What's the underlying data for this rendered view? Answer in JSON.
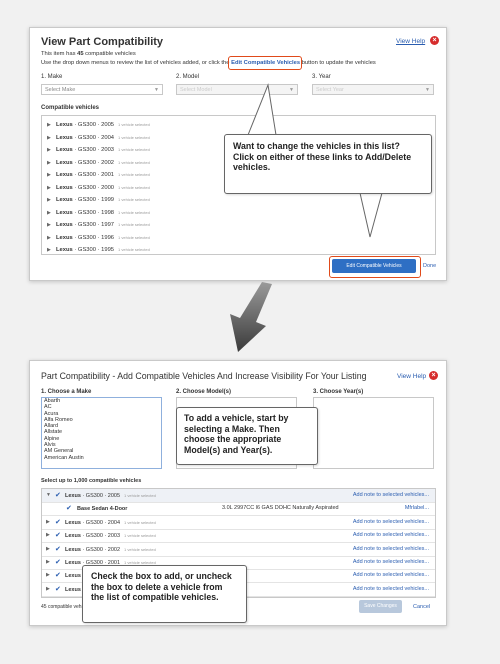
{
  "top": {
    "title": "View Part Compatibility",
    "help": "View Help",
    "line1_pre": "This item has ",
    "line1_count": "45",
    "line1_post": " compatible vehicles",
    "line2_pre": "Use the drop down menus to review the list of vehicles added, or click the",
    "line2_link": "Edit Compatible Vehicles",
    "line2_post": "button to update the vehicles",
    "make_label": "1. Make",
    "model_label": "2. Model",
    "year_label": "3. Year",
    "make_value": "Select Make",
    "model_value": "Select Model",
    "year_value": "Select Year",
    "list_title": "Compatible vehicles",
    "rows": [
      {
        "name": "Lexus",
        "desc": "· GS300 · 2005",
        "sub": "1 vehicle selected"
      },
      {
        "name": "Lexus",
        "desc": "· GS300 · 2004",
        "sub": "1 vehicle selected"
      },
      {
        "name": "Lexus",
        "desc": "· GS300 · 2003",
        "sub": "1 vehicle selected"
      },
      {
        "name": "Lexus",
        "desc": "· GS300 · 2002",
        "sub": "1 vehicle selected"
      },
      {
        "name": "Lexus",
        "desc": "· GS300 · 2001",
        "sub": "1 vehicle selected"
      },
      {
        "name": "Lexus",
        "desc": "· GS300 · 2000",
        "sub": "1 vehicle selected"
      },
      {
        "name": "Lexus",
        "desc": "· GS300 · 1999",
        "sub": "1 vehicle selected"
      },
      {
        "name": "Lexus",
        "desc": "· GS300 · 1998",
        "sub": "1 vehicle selected"
      },
      {
        "name": "Lexus",
        "desc": "· GS300 · 1997",
        "sub": "1 vehicle selected"
      },
      {
        "name": "Lexus",
        "desc": "· GS300 · 1996",
        "sub": "1 vehicle selected"
      },
      {
        "name": "Lexus",
        "desc": "· GS300 · 1995",
        "sub": "1 vehicle selected"
      }
    ],
    "edit_button": "Edit Compatible Vehicles",
    "done": "Done",
    "callout": "Want to change the vehicles in this list? Click on either of these links to Add/Delete vehicles."
  },
  "bottom": {
    "title": "Part Compatibility - Add Compatible Vehicles And Increase Visibility For Your Listing",
    "help": "View Help",
    "make_label": "1. Choose a Make",
    "model_label": "2. Choose Model(s)",
    "year_label": "3. Choose Year(s)",
    "makes": [
      "Abarth",
      "AC",
      "Acura",
      "Alfa Romeo",
      "Allard",
      "Allstate",
      "Alpine",
      "Alvis",
      "AM General",
      "American Austin"
    ],
    "callout1": "To add a vehicle, start by selecting a Make. Then choose the appropriate Model(s) and Year(s).",
    "select_title": "Select up to 1,000 compatible vehicles",
    "rows": [
      {
        "name": "Lexus",
        "desc": "· GS300 · 2005",
        "sub": "1 vehicle selected",
        "note": "Add note to selected vehicles...",
        "tri": "▼"
      },
      {
        "name": "Base Sedan 4-Door",
        "desc": "",
        "sub": "",
        "note": "Mfrlabel...",
        "tri": "",
        "engine": "3.0L 2997CC l6 GAS DOHC Naturally Aspirated"
      },
      {
        "name": "Lexus",
        "desc": "· GS300 · 2004",
        "sub": "1 vehicle selected",
        "note": "Add note to selected vehicles...",
        "tri": "▶"
      },
      {
        "name": "Lexus",
        "desc": "· GS300 · 2003",
        "sub": "1 vehicle selected",
        "note": "Add note to selected vehicles...",
        "tri": "▶"
      },
      {
        "name": "Lexus",
        "desc": "· GS300 · 2002",
        "sub": "1 vehicle selected",
        "note": "Add note to selected vehicles...",
        "tri": "▶"
      },
      {
        "name": "Lexus",
        "desc": "· GS300 · 2001",
        "sub": "1 vehicle selected",
        "note": "Add note to selected vehicles...",
        "tri": "▶"
      },
      {
        "name": "Lexus",
        "desc": "",
        "sub": "",
        "note": "Add note to selected vehicles...",
        "tri": "▶"
      },
      {
        "name": "Lexus",
        "desc": "",
        "sub": "",
        "note": "Add note to selected vehicles...",
        "tri": "▶"
      }
    ],
    "callout2": "Check the box to add, or uncheck the box to delete a vehicle from the list of compatible vehicles.",
    "footer_count": "45 compatible vehicles",
    "save": "Save Changes",
    "cancel": "Cancel"
  },
  "colors": {
    "accent": "#2e6fc4",
    "highlight": "#e04a1a",
    "close": "#d62d2d"
  }
}
